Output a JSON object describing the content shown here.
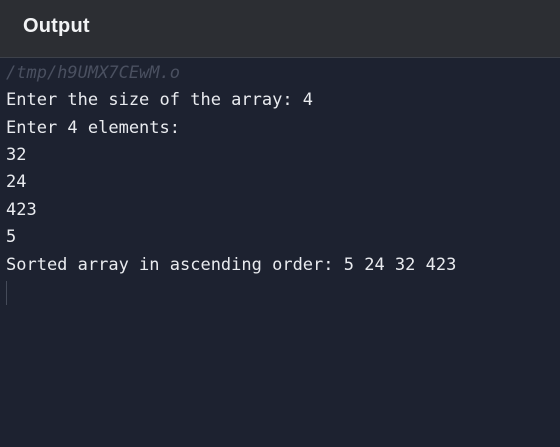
{
  "header": {
    "title": "Output"
  },
  "console": {
    "file_path": "/tmp/h9UMX7CEwM.o",
    "lines": [
      "Enter the size of the array: 4",
      "Enter 4 elements:",
      "32",
      "24",
      "423",
      "5",
      "Sorted array in ascending order: 5 24 32 423"
    ]
  },
  "colors": {
    "header_bg": "#2c2e33",
    "console_bg": "#1d2230",
    "text": "#e9ebef",
    "path_text": "#4a5060"
  }
}
